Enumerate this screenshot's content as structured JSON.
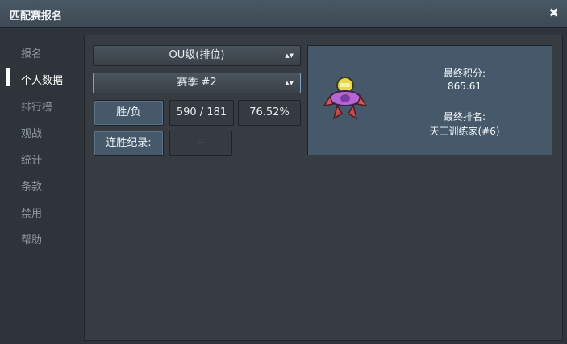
{
  "window": {
    "title": "匹配赛报名",
    "close_icon": "close-icon"
  },
  "sidebar": {
    "items": [
      {
        "label": "报名"
      },
      {
        "label": "个人数据"
      },
      {
        "label": "排行榜"
      },
      {
        "label": "观战"
      },
      {
        "label": "统计"
      },
      {
        "label": "条款"
      },
      {
        "label": "禁用"
      },
      {
        "label": "帮助"
      }
    ],
    "active_index": 1
  },
  "stats": {
    "tier_select": "OU级(排位)",
    "season_select": "赛季 #2",
    "win_loss_label": "胜/负",
    "win_loss_value": "590 / 181",
    "win_rate": "76.52%",
    "streak_label": "连胜纪录:",
    "streak_value": "--"
  },
  "result_card": {
    "final_score_label": "最终积分:",
    "final_score_value": "865.61",
    "final_rank_label": "最终排名:",
    "final_rank_value": "天王训练家(#6)",
    "icon": "pokemon-sprite-icon"
  },
  "colors": {
    "accent": "#45596a",
    "card": "#46596b",
    "background": "#2e3439"
  }
}
